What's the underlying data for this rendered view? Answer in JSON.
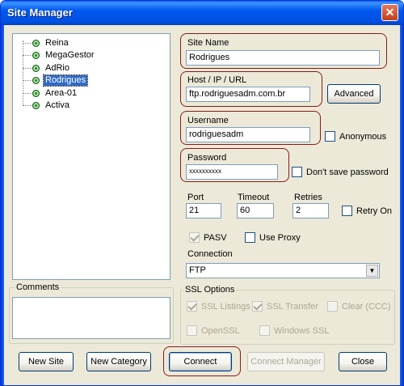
{
  "window": {
    "title": "Site Manager",
    "close_glyph": "✕"
  },
  "sites": [
    {
      "label": "Reina",
      "selected": false
    },
    {
      "label": "MegaGestor",
      "selected": false
    },
    {
      "label": "AdRio",
      "selected": false
    },
    {
      "label": "Rodrigues",
      "selected": true
    },
    {
      "label": "Area-01",
      "selected": false
    },
    {
      "label": "Activa",
      "selected": false
    }
  ],
  "comments": {
    "label": "Comments",
    "value": ""
  },
  "site_name": {
    "label": "Site Name",
    "value": "Rodrigues"
  },
  "host": {
    "label": "Host / IP / URL",
    "value": "ftp.rodriguesadm.com.br",
    "advanced_label": "Advanced"
  },
  "username": {
    "label": "Username",
    "value": "rodriguesadm",
    "anonymous_label": "Anonymous",
    "anonymous_checked": false
  },
  "password": {
    "label": "Password",
    "value": "xxxxxxxxxx",
    "dont_save_label": "Don't save password",
    "dont_save_checked": false
  },
  "port": {
    "label": "Port",
    "value": "21"
  },
  "timeout": {
    "label": "Timeout",
    "value": "60"
  },
  "retries": {
    "label": "Retries",
    "value": "2",
    "retry_on_label": "Retry On",
    "retry_on_checked": false
  },
  "pasv": {
    "label": "PASV",
    "checked": true
  },
  "use_proxy": {
    "label": "Use Proxy",
    "checked": false
  },
  "connection": {
    "label": "Connection",
    "value": "FTP"
  },
  "ssl": {
    "group_label": "SSL Options",
    "ssl_listings": {
      "label": "SSL Listings",
      "checked": true
    },
    "ssl_transfer": {
      "label": "SSL Transfer",
      "checked": true
    },
    "clear_ccc": {
      "label": "Clear (CCC)",
      "checked": false
    },
    "openssl": {
      "label": "OpenSSL",
      "checked": false
    },
    "windows_ssl": {
      "label": "Windows SSL",
      "checked": false
    }
  },
  "buttons": {
    "new_site": "New Site",
    "new_category": "New Category",
    "connect": "Connect",
    "connect_manager": "Connect Manager",
    "close": "Close"
  },
  "colors": {
    "title_bar": "#0058ee",
    "highlight_outline": "#8b1a1a",
    "selection": "#316ac5"
  }
}
